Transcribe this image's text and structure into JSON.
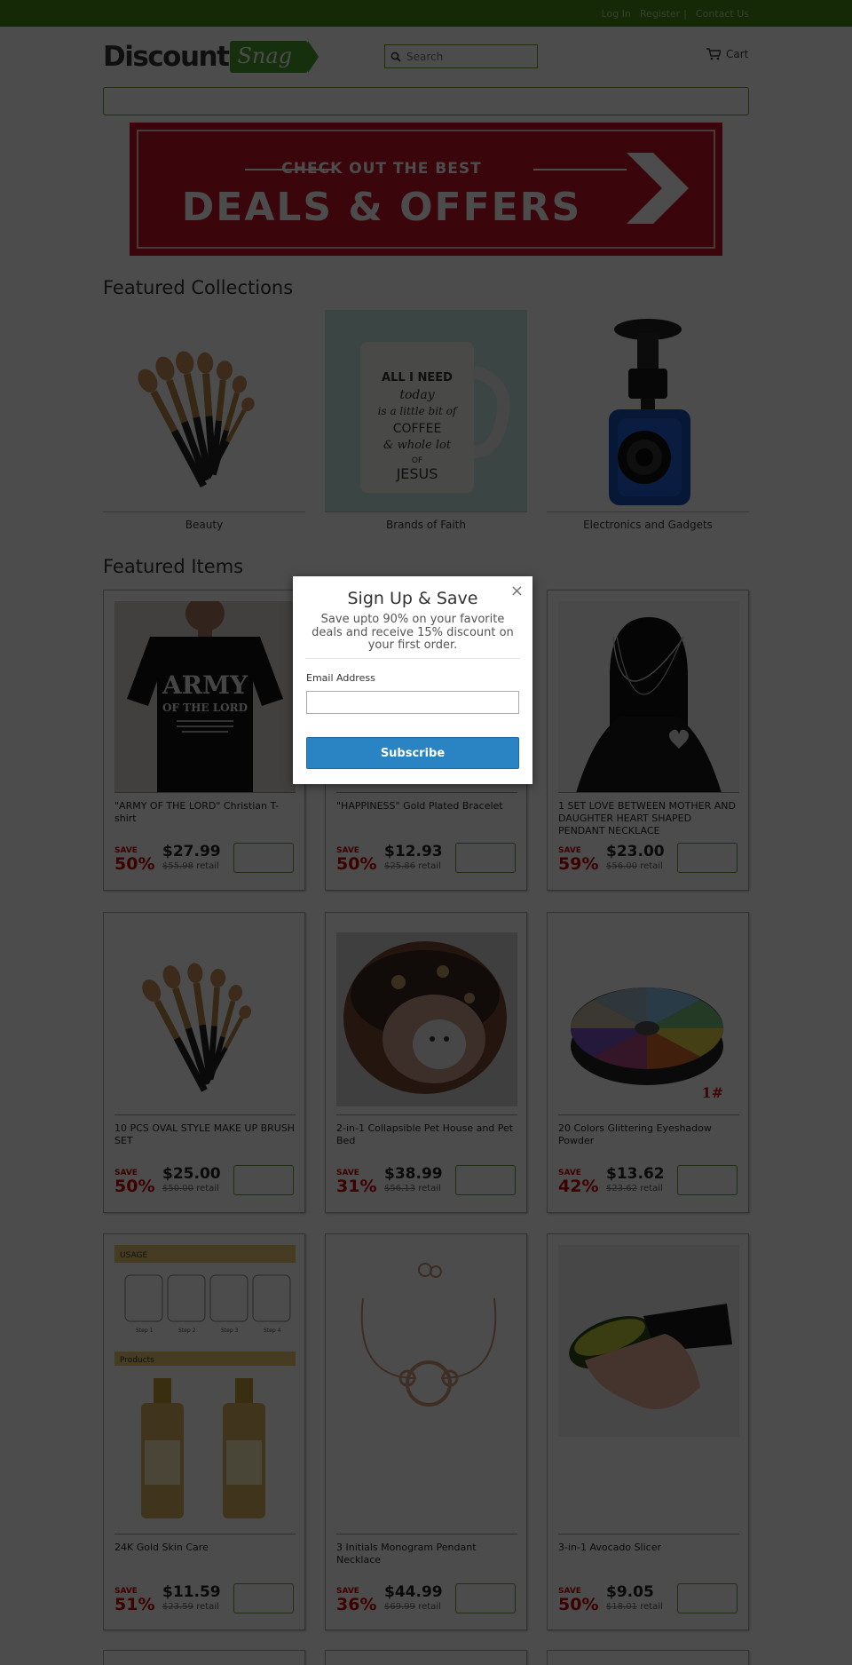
{
  "topbar": {
    "login": "Log In",
    "register": "Register",
    "sep": "|",
    "contact": "Contact Us"
  },
  "header": {
    "logo_word": "Discount",
    "logo_tag": "Snag",
    "search_placeholder": "Search",
    "cart_label": "Cart"
  },
  "banner": {
    "line1": "CHECK OUT THE BEST",
    "line2": "DEALS & OFFERS"
  },
  "featured_collections": {
    "heading": "Featured Collections",
    "items": [
      {
        "label": "Beauty"
      },
      {
        "label": "Brands of Faith"
      },
      {
        "label": "Electronics and Gadgets"
      }
    ]
  },
  "featured_items": {
    "heading": "Featured Items",
    "save_label": "SAVE",
    "retail_label": "retail",
    "products": [
      {
        "title": "\"ARMY OF THE LORD\" Christian T-shirt",
        "pct": "50%",
        "price": "$27.99",
        "old": "$55.98",
        "img": "tshirt"
      },
      {
        "title": "\"HAPPINESS\" Gold Plated Bracelet",
        "pct": "50%",
        "price": "$12.93",
        "old": "$25.86",
        "img": "bracelet"
      },
      {
        "title": "1 SET LOVE BETWEEN MOTHER AND DAUGHTER HEART SHAPED PENDANT NECKLACE",
        "pct": "59%",
        "price": "$23.00",
        "old": "$56.00",
        "img": "necklace"
      },
      {
        "title": "10 PCS OVAL STYLE MAKE UP BRUSH SET",
        "pct": "50%",
        "price": "$25.00",
        "old": "$50.00",
        "img": "brushes"
      },
      {
        "title": "2-in-1 Collapsible Pet House and Pet Bed",
        "pct": "31%",
        "price": "$38.99",
        "old": "$56.13",
        "img": "petbed"
      },
      {
        "title": "20 Colors Glittering Eyeshadow Powder",
        "pct": "42%",
        "price": "$13.62",
        "old": "$23.62",
        "img": "eyeshadow"
      },
      {
        "title": "24K Gold Skin Care",
        "pct": "51%",
        "price": "$11.59",
        "old": "$23.59",
        "img": "skincare"
      },
      {
        "title": "3 Initials Monogram Pendant Necklace",
        "pct": "36%",
        "price": "$44.99",
        "old": "$69.99",
        "img": "monogram"
      },
      {
        "title": "3-in-1 Avocado Slicer",
        "pct": "50%",
        "price": "$9.05",
        "old": "$18.01",
        "img": "avocado"
      }
    ]
  },
  "image_text": {
    "shirt_line1": "ARMY",
    "shirt_line2": "OF THE LORD",
    "eyeshadow_mark": "1#",
    "skincare_usage": "USAGE",
    "skincare_products": "Products",
    "skincare_steps": [
      "Step 1",
      "Step 2",
      "Step 3",
      "Step 4"
    ],
    "mug_lines": [
      "ALL I NEED",
      "today",
      "is a little bit of",
      "COFFEE",
      "& whole lot",
      "OF",
      "JESUS"
    ]
  },
  "modal": {
    "title": "Sign Up & Save",
    "text": "Save upto 90% on your favorite deals and receive 15% discount on your first order.",
    "email_label": "Email Address",
    "button": "Subscribe",
    "close": "×"
  }
}
